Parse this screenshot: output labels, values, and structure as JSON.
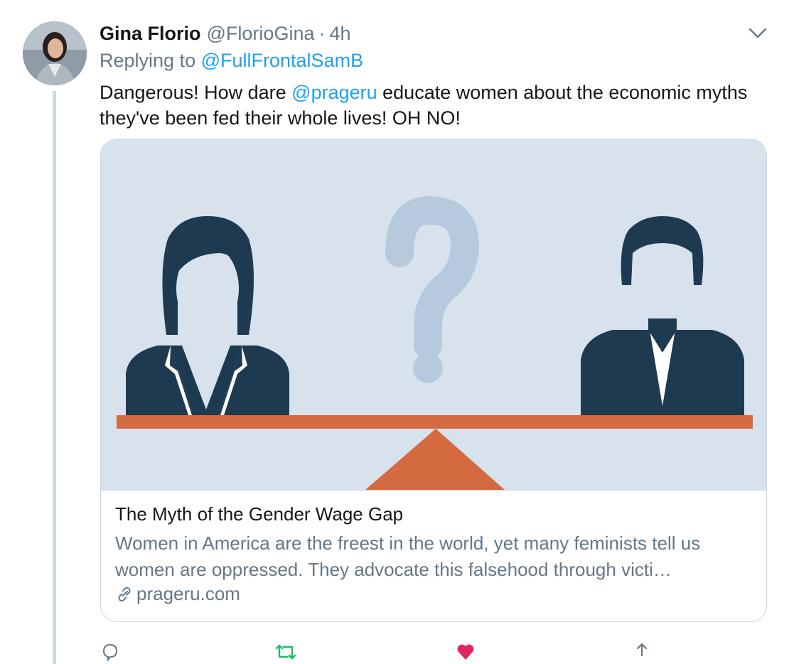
{
  "tweet": {
    "author_name": "Gina Florio",
    "author_handle": "@FlorioGina",
    "separator": "·",
    "time": "4h",
    "replying_prefix": "Replying to",
    "replying_to": "@FullFrontalSamB",
    "text_before_mention": "Dangerous! How dare ",
    "mention": "@prageru",
    "text_after_mention": " educate women about the economic myths they've been fed their whole lives! OH NO!"
  },
  "card": {
    "title": "The Myth of the Gender Wage Gap",
    "description": "Women in America are the freest in the world, yet many feminists tell us women are oppressed. They advocate this falsehood through victi…",
    "domain": "prageru.com",
    "image_icons": [
      "woman-silhouette-icon",
      "question-mark-icon",
      "man-silhouette-icon",
      "seesaw-icon"
    ]
  },
  "actions": {
    "reply_icon": "reply-icon",
    "retweet_icon": "retweet-icon",
    "like_icon": "heart-icon",
    "share_icon": "share-icon"
  },
  "colors": {
    "link": "#1da1f2",
    "secondary_text": "#657786",
    "image_background": "#d8e2ec",
    "figure": "#1d3a51",
    "seesaw": "#d46a3f",
    "question_mark": "#b7cadd",
    "like": "#e0245e",
    "retweet": "#17bf63"
  }
}
